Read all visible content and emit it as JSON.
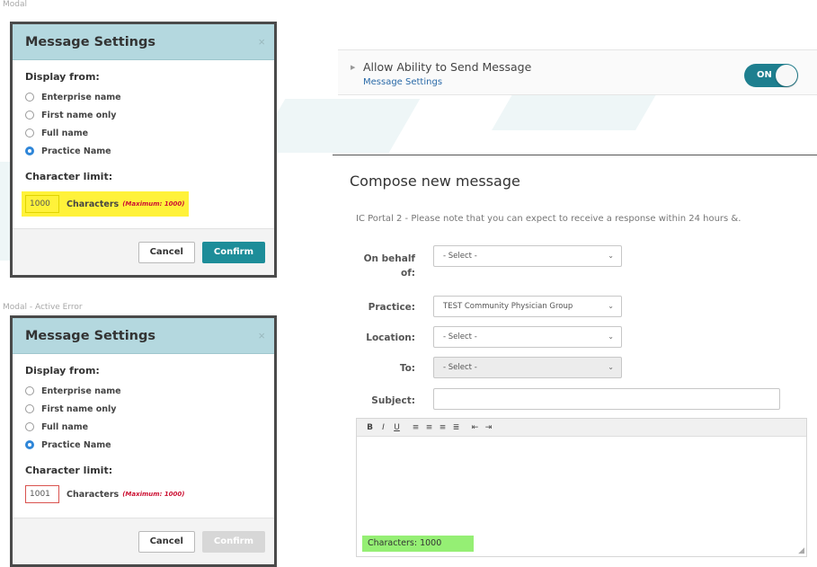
{
  "captions": {
    "modal": "Modal",
    "modal_error": "Modal - Active Error"
  },
  "modal_default": {
    "title": "Message Settings",
    "close": "×",
    "display_from_label": "Display from:",
    "options": [
      "Enterprise name",
      "First name only",
      "Full name",
      "Practice Name"
    ],
    "selected_option": "Practice Name",
    "char_limit_label": "Character limit:",
    "char_value": "1000",
    "characters_label": "Characters",
    "max_note": "(Maximum: 1000)",
    "cancel_label": "Cancel",
    "confirm_label": "Confirm",
    "highlight_color": "#fff23a"
  },
  "modal_error": {
    "title": "Message Settings",
    "close": "×",
    "display_from_label": "Display from:",
    "options": [
      "Enterprise name",
      "First name only",
      "Full name",
      "Practice Name"
    ],
    "selected_option": "Practice Name",
    "char_limit_label": "Character limit:",
    "char_value": "1001",
    "characters_label": "Characters",
    "max_note": "(Maximum: 1000)",
    "cancel_label": "Cancel",
    "confirm_label": "Confirm",
    "confirm_disabled": true,
    "error_color": "#cc1133"
  },
  "setting_toggle": {
    "title": "Allow Ability to Send Message",
    "link": "Message Settings",
    "state": "ON",
    "color": "#1e7f8f"
  },
  "compose": {
    "title": "Compose new message",
    "note": "IC Portal 2 - Please note that you can expect to receive a response within 24 hours &.",
    "fields": {
      "on_behalf_label_1": "On behalf",
      "on_behalf_label_2": "of:",
      "on_behalf_value": "- Select -",
      "practice_label": "Practice:",
      "practice_value": "TEST Community Physician Group",
      "location_label": "Location:",
      "location_value": "- Select -",
      "to_label": "To:",
      "to_value": "- Select -",
      "subject_label": "Subject:",
      "subject_value": ""
    },
    "toolbar": [
      "B",
      "I",
      "U",
      "align-left",
      "align-center",
      "align-right",
      "justify",
      "outdent",
      "indent"
    ],
    "char_counter": "Characters: 1000",
    "counter_color": "#95ef74"
  },
  "accent_color": "#1d8d99"
}
